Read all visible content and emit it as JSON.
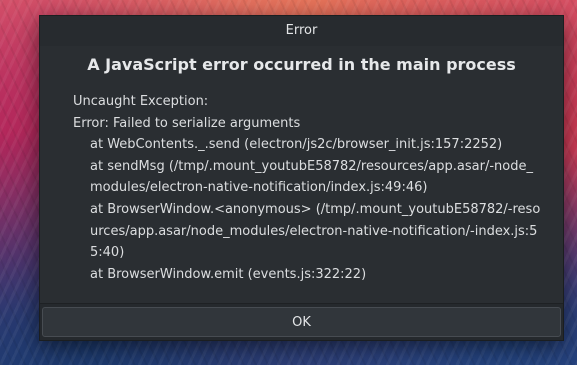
{
  "dialog": {
    "title": "Error",
    "heading": "A JavaScript error occurred in the main process",
    "message": {
      "line1": "Uncaught Exception:",
      "line2": "Error: Failed to serialize arguments",
      "stack": [
        "at WebContents._.send (electron/js2c/browser_init.js:157:2252)",
        "at sendMsg (/tmp/.mount_youtubE58782/resources/app.asar/-node_modules/electron-native-notification/index.js:49:46)",
        "at BrowserWindow.<anonymous> (/tmp/.mount_youtubE58782/-resources/app.asar/node_modules/electron-native-notification/-index.js:55:40)",
        "at BrowserWindow.emit (events.js:322:22)"
      ]
    },
    "ok_label": "OK"
  },
  "colors": {
    "dialog_bg": "#2a2e32",
    "text": "#dcdee0",
    "button_bg": "#31363b",
    "button_border": "#474c52"
  }
}
